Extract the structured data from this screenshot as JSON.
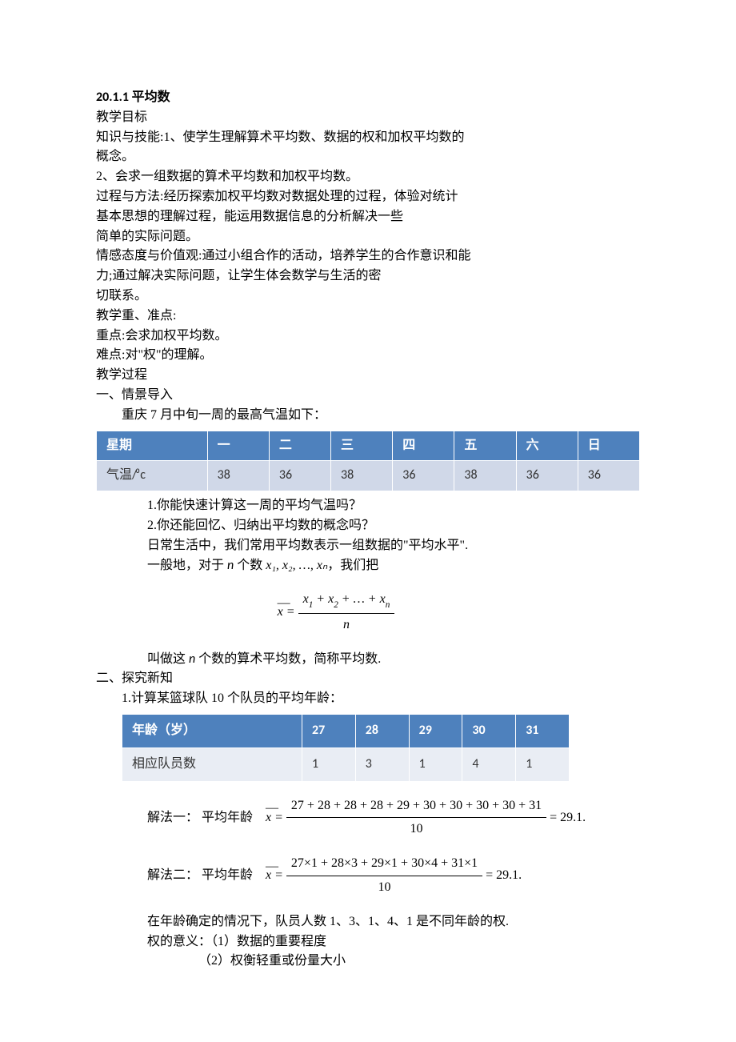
{
  "title": "20.1.1 平均数",
  "objectives_h": "教学目标",
  "knowledge_h": "知识与技能:1、使学生理解算术平均数、数据的权和加权平均数的",
  "knowledge_l2": "概念。",
  "knowledge_l3": "2、会求一组数据的算术平均数和加权平均数。",
  "process_l1": "过程与方法:经历探索加权平均数对数据处理的过程，体验对统计",
  "process_l2": "基本思想的理解过程，能运用数据信息的分析解决一些",
  "process_l3": "简单的实际问题。",
  "attitude_l1": "情感态度与价值观:通过小组合作的活动，培养学生的合作意识和能",
  "attitude_l2": "力;通过解决实际问题，让学生体会数学与生活的密",
  "attitude_l3": "切联系。",
  "focus_h": "教学重、准点:",
  "focus_l1": "重点:会求加权平均数。",
  "focus_l2": "难点:对\"权\"的理解。",
  "proc_h": "教学过程",
  "sec1_h": "一、情景导入",
  "sec1_intro": "重庆 7 月中旬一周的最高气温如下：",
  "table1": {
    "headers": [
      "星期",
      "一",
      "二",
      "三",
      "四",
      "五",
      "六",
      "日"
    ],
    "row_label": "气温/⁰c",
    "values": [
      "38",
      "36",
      "38",
      "36",
      "38",
      "36",
      "36"
    ]
  },
  "q1": "1.你能快速计算这一周的平均气温吗？",
  "q2": "2.你还能回忆、归纳出平均数的概念吗？",
  "life": "日常生活中，我们常用平均数表示一组数据的\"平均水平\".",
  "general_prefix": "一般地，对于 ",
  "general_n": "n",
  "general_mid": " 个数 ",
  "general_vars": "x₁, x₂, …, xₙ",
  "general_suffix": "，我们把",
  "formula1": {
    "num": "x₁ + x₂ + … + xₙ",
    "den": "n"
  },
  "def_prefix": "叫做这 ",
  "def_n": "n",
  "def_suffix": " 个数的算术平均数，简称平均数.",
  "sec2_h": "二、探究新知",
  "sec2_q": "1.计算某篮球队 10 个队员的平均年龄：",
  "table2": {
    "headers": [
      "年龄（岁）",
      "27",
      "28",
      "29",
      "30",
      "31"
    ],
    "row_label": "相应队员数",
    "values": [
      "1",
      "3",
      "1",
      "4",
      "1"
    ]
  },
  "sol1_label": "解法一：  平均年龄",
  "sol1_num": "27 + 28 + 28 + 28 + 29 + 30 + 30 + 30 + 30 + 31",
  "sol1_den": "10",
  "sol1_res": " = 29.1.",
  "sol2_label": "解法二：  平均年龄",
  "sol2_num": "27×1 + 28×3 + 29×1 + 30×4 + 31×1",
  "sol2_den": "10",
  "sol2_res": " = 29.1.",
  "weight_note": "在年龄确定的情况下，队员人数 1、3、1、4、1 是不同年龄的权.",
  "weight_mean_h": "权的意义：（1）数据的重要程度",
  "weight_mean_2": "（2）权衡轻重或份量大小",
  "chart_data": [
    {
      "type": "table",
      "title": "重庆7月中旬一周最高气温",
      "categories": [
        "一",
        "二",
        "三",
        "四",
        "五",
        "六",
        "日"
      ],
      "series": [
        {
          "name": "气温/⁰c",
          "values": [
            38,
            36,
            38,
            36,
            38,
            36,
            36
          ]
        }
      ]
    },
    {
      "type": "table",
      "title": "篮球队队员年龄分布",
      "categories": [
        27,
        28,
        29,
        30,
        31
      ],
      "series": [
        {
          "name": "相应队员数",
          "values": [
            1,
            3,
            1,
            4,
            1
          ]
        }
      ]
    }
  ]
}
